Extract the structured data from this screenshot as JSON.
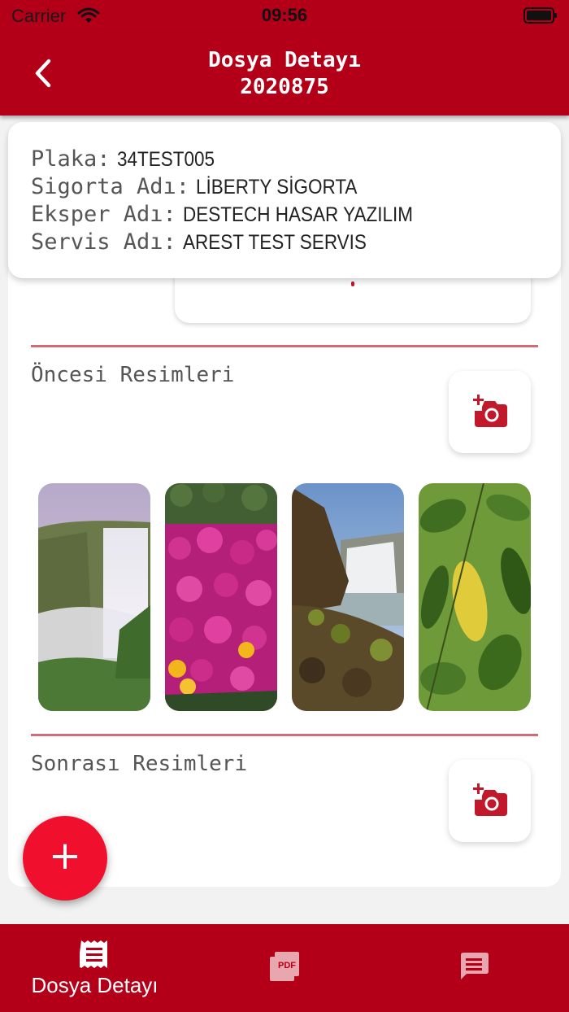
{
  "status_bar": {
    "carrier": "Carrier",
    "time": "09:56"
  },
  "header": {
    "title": "Dosya Detayı",
    "subtitle": "2020875"
  },
  "info": {
    "rows": [
      {
        "label": "Plaka:",
        "value": "34TEST005"
      },
      {
        "label": "Sigorta Adı:",
        "value": "LİBERTY SİGORTA"
      },
      {
        "label": "Eksper Adı:",
        "value": "DESTECH HASAR YAZILIM"
      },
      {
        "label": "Servis Adı:",
        "value": "AREST TEST SERVIS"
      }
    ]
  },
  "sections": {
    "before": {
      "title": "Öncesi Resimleri",
      "add_icon": "add-photo-camera-icon"
    },
    "after": {
      "title": "Sonrası Resimleri",
      "add_icon": "add-photo-camera-icon"
    }
  },
  "photos": [
    "waterfall",
    "pink-flowers",
    "waterfall-rocks",
    "citrus-leaves"
  ],
  "fab": {
    "label": "+"
  },
  "tabs": [
    {
      "label": "Dosya Detayı",
      "icon": "receipt-icon",
      "selected": true
    },
    {
      "label": "",
      "icon": "pdf-icon",
      "selected": false
    },
    {
      "label": "",
      "icon": "message-icon",
      "selected": false
    }
  ],
  "colors": {
    "primary": "#b30018",
    "accent": "#f0102d",
    "divider": "#d46a78"
  }
}
